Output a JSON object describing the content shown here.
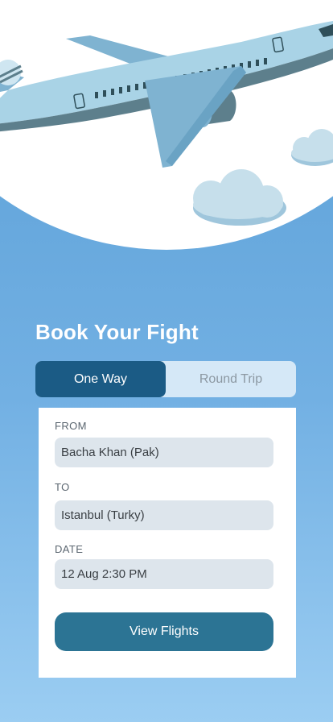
{
  "header": {
    "title": "Book Your Fight"
  },
  "trip_type": {
    "options": [
      "One Way",
      "Round Trip"
    ],
    "selected": "One Way"
  },
  "form": {
    "from_label": "FROM",
    "from_value": "Bacha Khan (Pak)",
    "to_label": "TO",
    "to_value": "Istanbul (Turky)",
    "date_label": "DATE",
    "date_value": "12 Aug 2:30 PM"
  },
  "actions": {
    "view_flights": "View Flights"
  },
  "colors": {
    "background_top": "#5a9fd6",
    "background_bottom": "#9bcdf2",
    "accent_dark": "#1b5b85",
    "button": "#2c7494",
    "field": "#dde5ec"
  },
  "illustration": {
    "icons": [
      "airplane-icon",
      "cloud-icon"
    ]
  }
}
